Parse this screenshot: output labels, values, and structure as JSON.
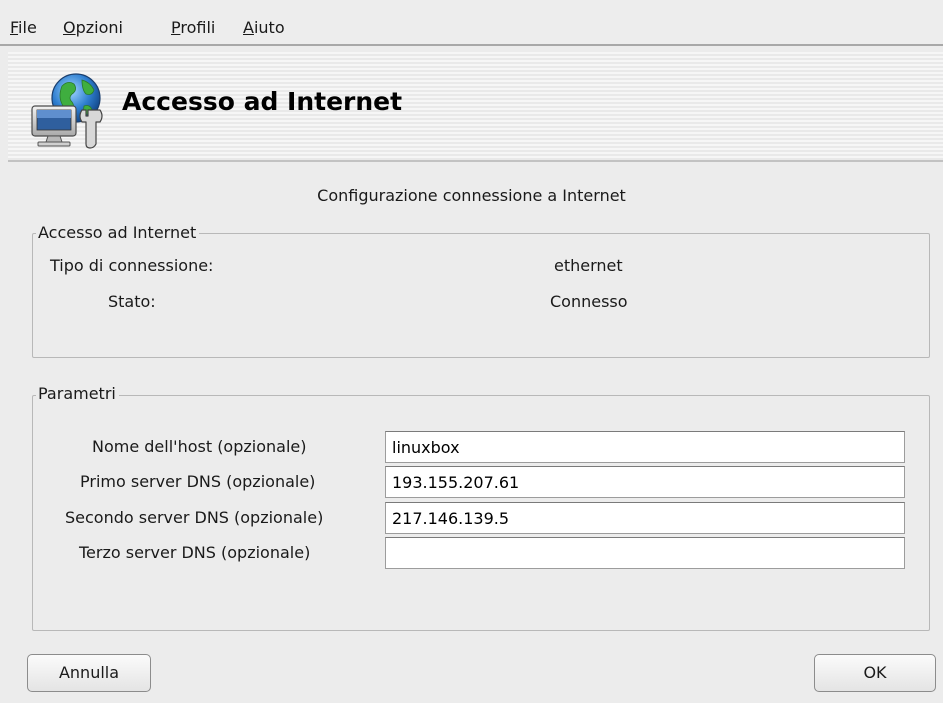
{
  "menubar": {
    "items": [
      {
        "accel": "F",
        "rest": "ile"
      },
      {
        "accel": "O",
        "rest": "pzioni"
      },
      {
        "accel": "P",
        "rest": "rofili"
      },
      {
        "accel": "A",
        "rest": "iuto"
      }
    ]
  },
  "banner": {
    "title": "Accesso ad Internet",
    "icon": "network-globe-wrench-icon"
  },
  "subtitle": "Configurazione connessione a Internet",
  "internet_group": {
    "legend": "Accesso ad Internet",
    "connection_type_label": "Tipo di connessione:",
    "connection_type_value": "ethernet",
    "status_label": "Stato:",
    "status_value": "Connesso"
  },
  "params_group": {
    "legend": "Parametri",
    "fields": [
      {
        "label": "Nome dell'host (opzionale)",
        "value": "linuxbox"
      },
      {
        "label": "Primo server DNS (opzionale)",
        "value": "193.155.207.61"
      },
      {
        "label": "Secondo server DNS (opzionale)",
        "value": "217.146.139.5"
      },
      {
        "label": "Terzo server DNS (opzionale)",
        "value": ""
      }
    ]
  },
  "buttons": {
    "cancel": "Annulla",
    "ok": "OK"
  }
}
